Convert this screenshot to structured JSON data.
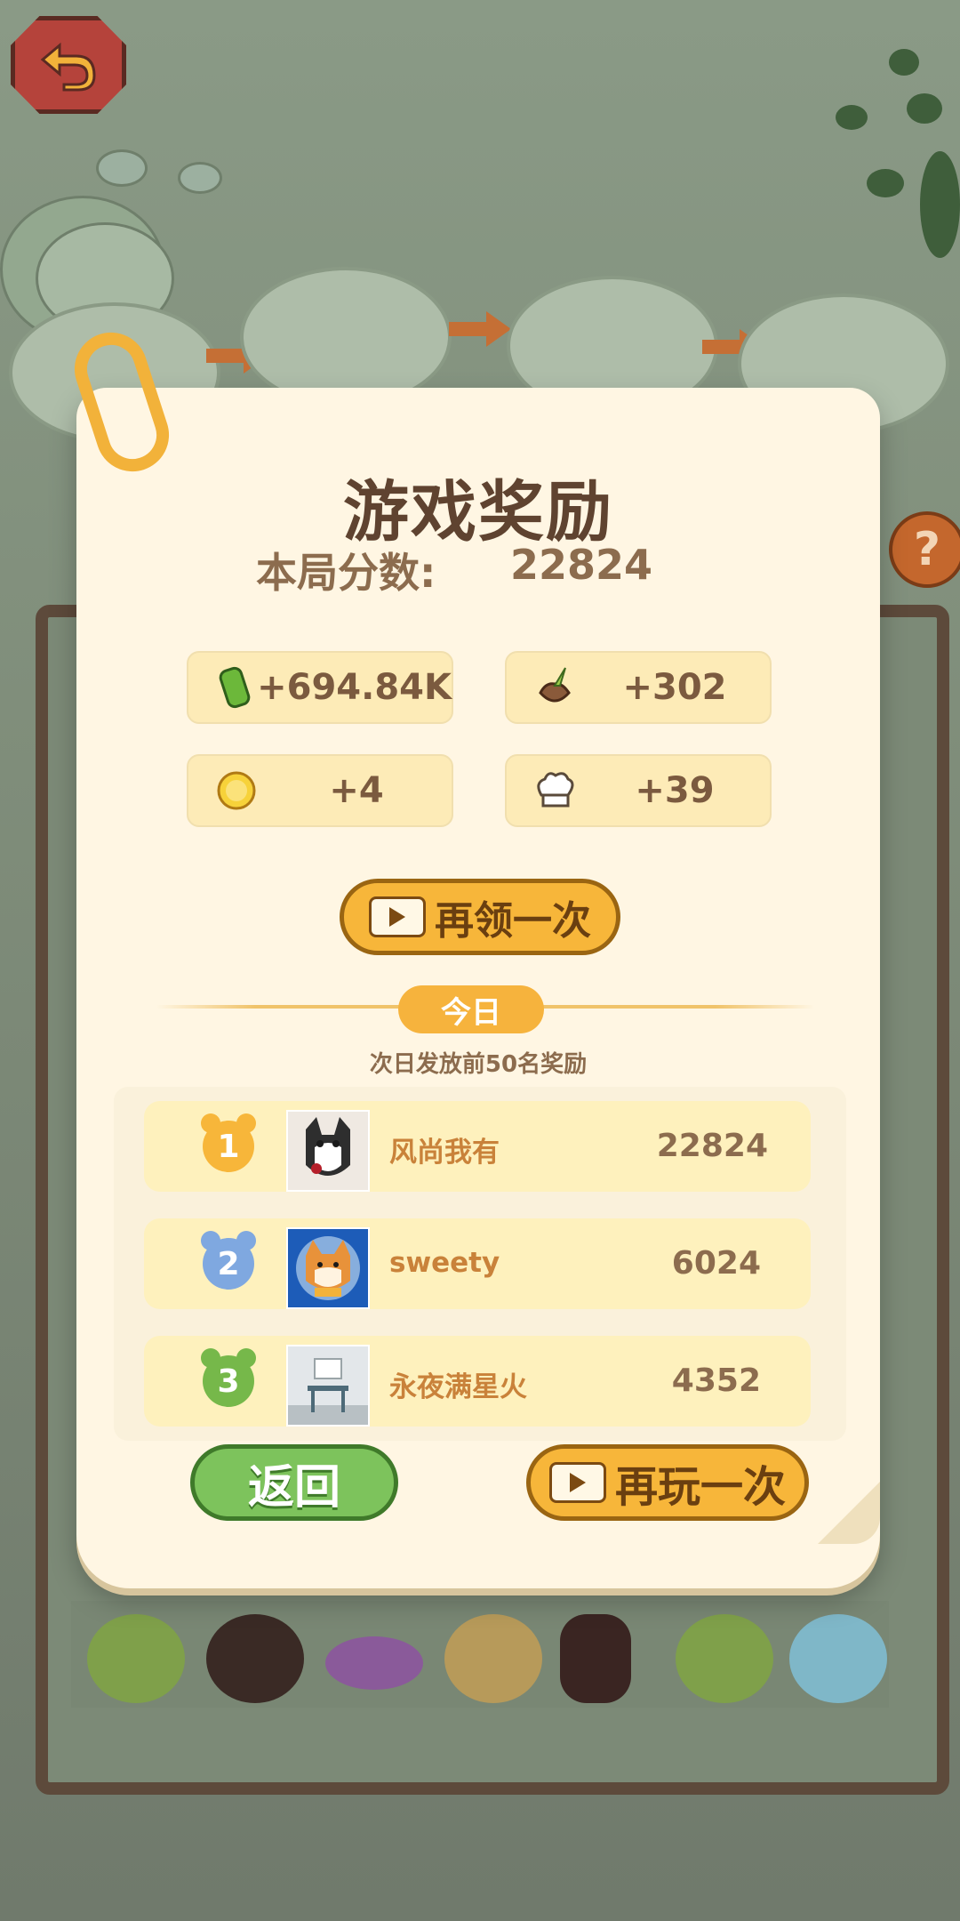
{
  "reward_card": {
    "title": "游戏奖励",
    "score_label": "本局分数:",
    "score_value": "22824",
    "rewards": [
      {
        "icon": "bamboo-coin-icon",
        "value": "+694.84K"
      },
      {
        "icon": "carrot-icon",
        "value": "+302"
      },
      {
        "icon": "sun-icon",
        "value": "+4"
      },
      {
        "icon": "chef-hat-icon",
        "value": "+39"
      }
    ],
    "claim_again_label": "再领一次",
    "today_label": "今日",
    "today_note": "次日发放前50名奖励"
  },
  "leaderboard": [
    {
      "rank": "1",
      "name": "风尚我有",
      "score": "22824",
      "medal_color": "#f7b63a"
    },
    {
      "rank": "2",
      "name": "sweety",
      "score": "6024",
      "medal_color": "#7fa8e0"
    },
    {
      "rank": "3",
      "name": "永夜满星火",
      "score": "4352",
      "medal_color": "#76b84a"
    }
  ],
  "buttons": {
    "back_label": "返回",
    "play_again_label": "再玩一次"
  },
  "top_controls": {
    "help_label": "?"
  },
  "colors": {
    "card_bg": "#fff6e3",
    "accent_orange": "#f7b63a",
    "accent_green": "#7dc35c",
    "title_brown": "#5f4330"
  }
}
